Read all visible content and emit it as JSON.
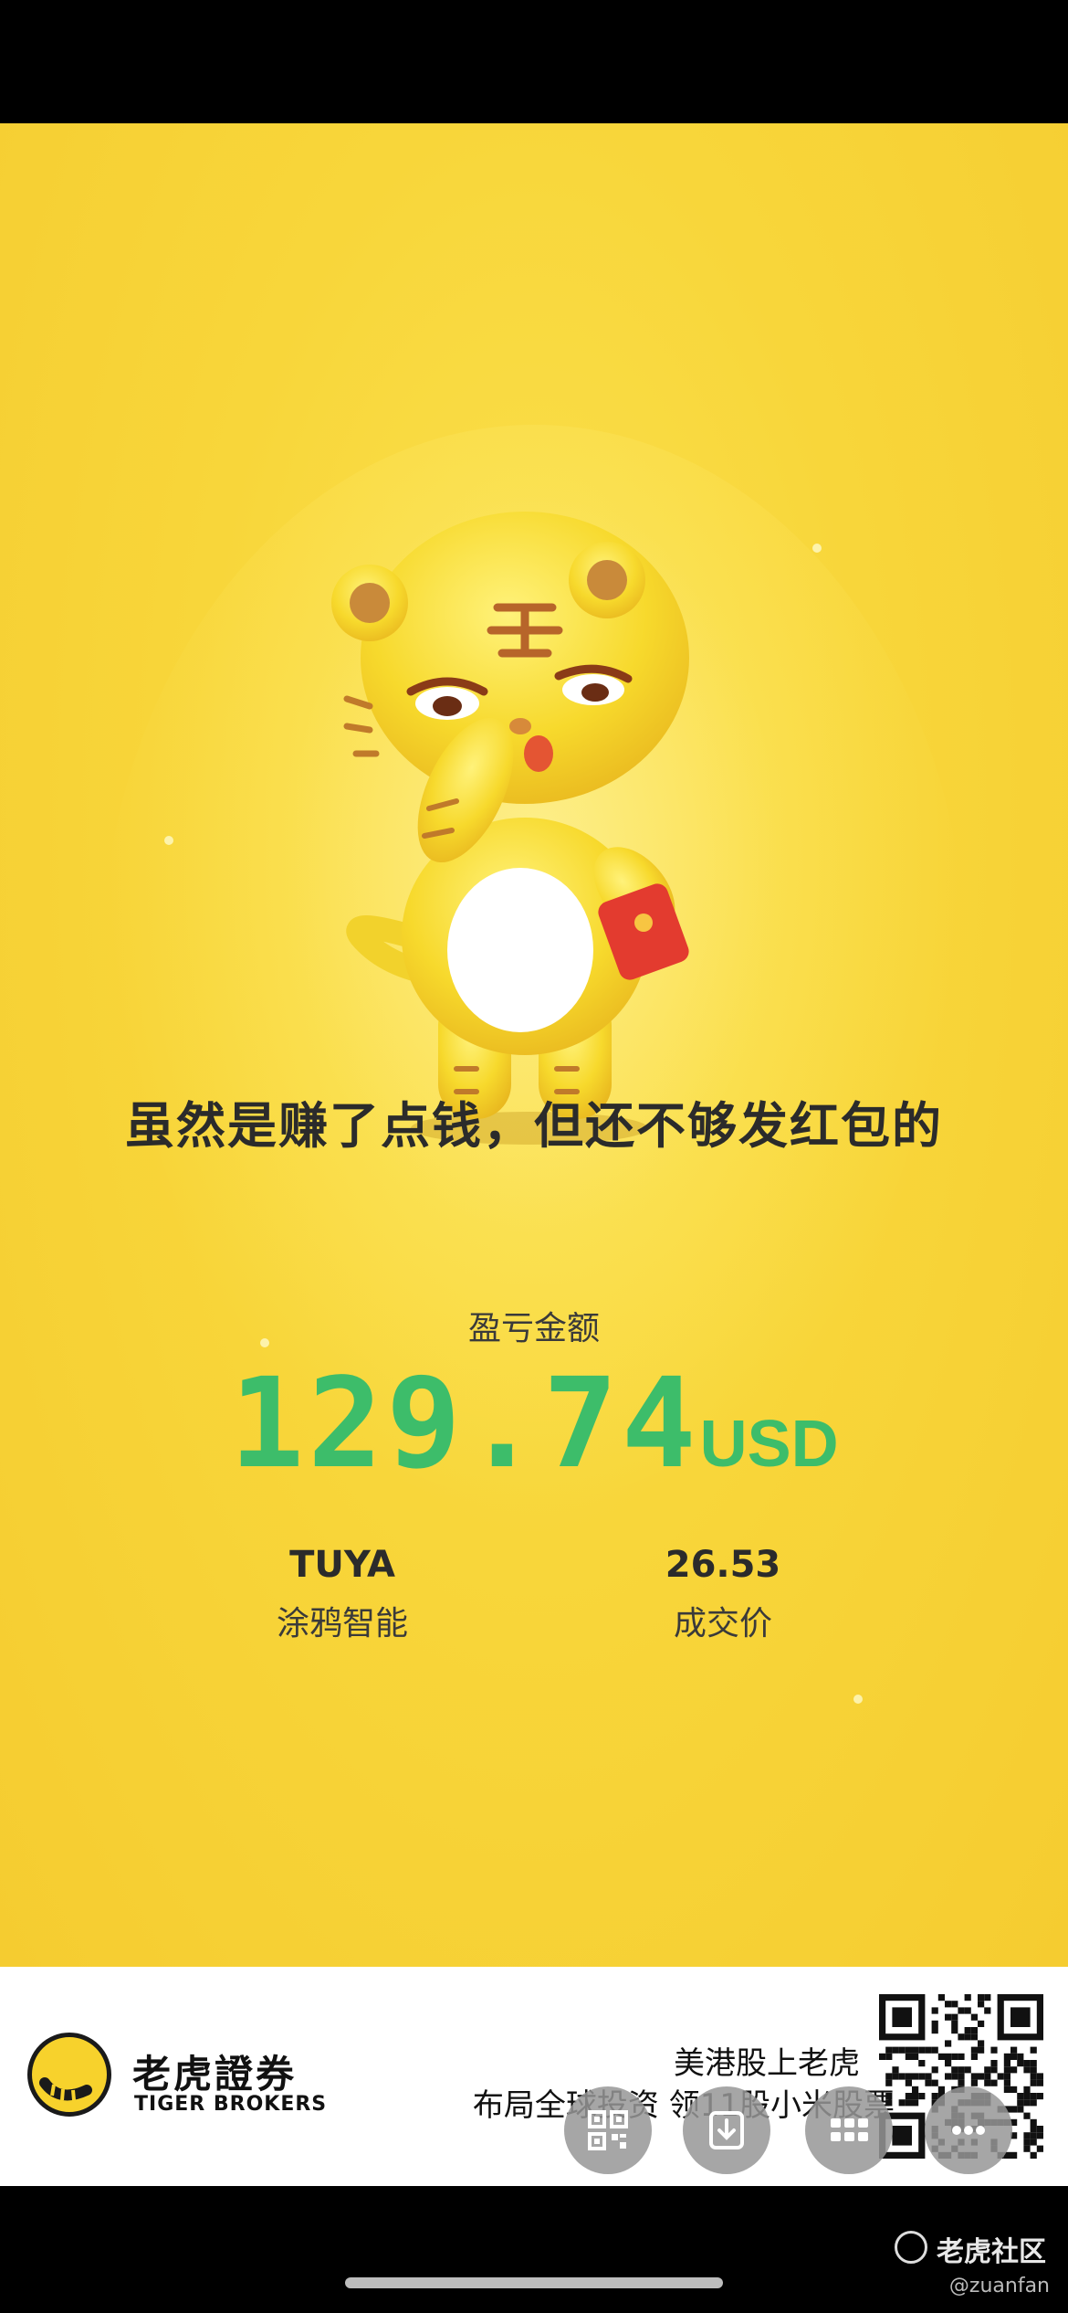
{
  "poster": {
    "slogan": "虽然是赚了点钱，但还不够发红包的",
    "pl_label": "盈亏金额",
    "pl_amount": "129.74",
    "pl_currency": "USD",
    "stock_symbol": "TUYA",
    "stock_name": "涂鸦智能",
    "price": "26.53",
    "price_label": "成交价",
    "accent_green": "#3dbd6a",
    "background_yellow": "#f8d63a"
  },
  "banner": {
    "brand_cn": "老虎證券",
    "brand_en": "TIGER BROKERS",
    "promo_line1": "美港股上老虎",
    "promo_line2": "布局全球投资 领11股小米股票"
  },
  "actions": [
    {
      "icon": "qr-code-icon"
    },
    {
      "icon": "download-icon"
    },
    {
      "icon": "grid-icon"
    },
    {
      "icon": "more-icon"
    }
  ],
  "watermark": {
    "label": "老虎社区",
    "handle": "@zuanfan"
  }
}
